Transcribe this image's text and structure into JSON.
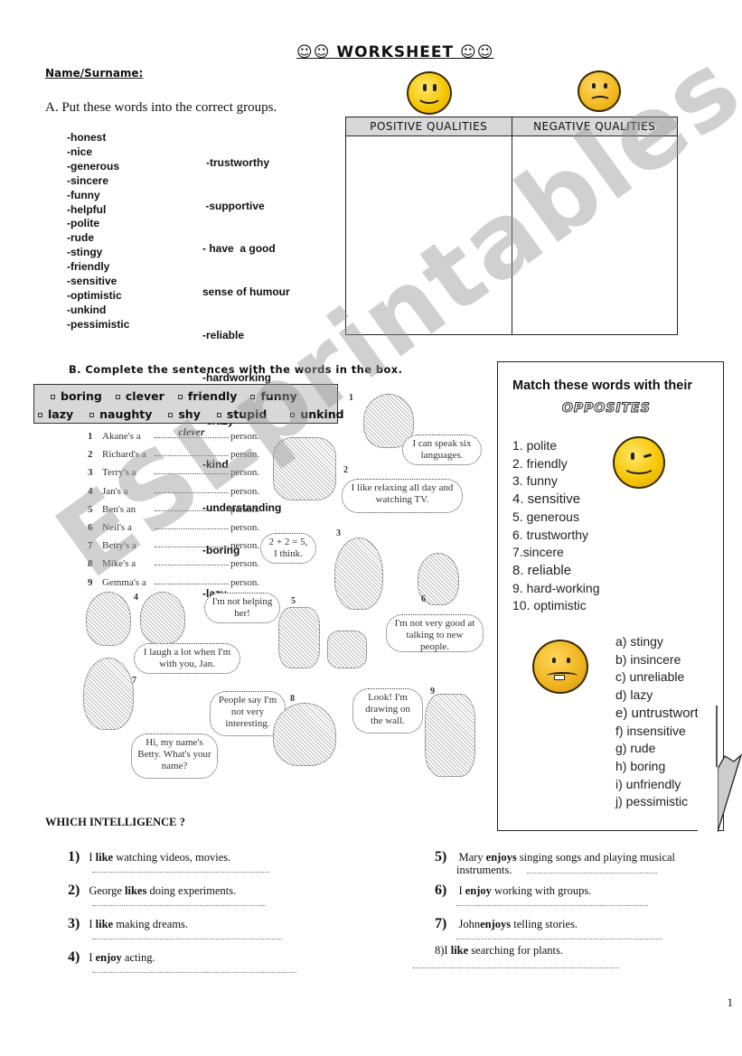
{
  "header": {
    "title": "☺☺ WORKSHEET ☺☺",
    "name_label": "Name/Surname:"
  },
  "section_a": {
    "instruction": "A.  Put these words into the correct groups.",
    "words_col1": [
      "-honest",
      "-nice",
      "-generous",
      "-sincere",
      "-funny",
      "-helpful",
      "-polite",
      "-rude",
      "-stingy",
      "-friendly",
      "-sensitive",
      "-optimistic",
      "-unkind",
      "-pessimistic"
    ],
    "words_col2": [
      "-trustworthy",
      " -supportive",
      "- have  a good",
      "sense of humour",
      "-reliable",
      "-hardworking",
      "-crazy",
      "-kind",
      "-understanding",
      "-boring",
      "-lazy"
    ],
    "table": {
      "positive_header": "POSITIVE QUALITIES",
      "negative_header": "NEGATIVE QUALITIES",
      "positive_icon": "happy-smiley-icon",
      "negative_icon": "sad-smiley-icon"
    }
  },
  "section_b": {
    "instruction": "B.  Complete the sentences with the words in the box.",
    "word_box_row1": [
      "boring",
      "clever",
      "friendly",
      "funny"
    ],
    "word_box_row2": [
      "lazy",
      "naughty",
      "shy",
      "stupid",
      "unkind"
    ],
    "sentences": [
      {
        "num": "1",
        "subject": "Akane's a",
        "answer": "clever",
        "end": "person."
      },
      {
        "num": "2",
        "subject": "Richard's a",
        "answer": "",
        "end": "person."
      },
      {
        "num": "3",
        "subject": "Terry's a",
        "answer": "",
        "end": "person."
      },
      {
        "num": "4",
        "subject": "Jan's a",
        "answer": "",
        "end": "person."
      },
      {
        "num": "5",
        "subject": "Ben's an",
        "answer": "",
        "end": "person."
      },
      {
        "num": "6",
        "subject": "Neil's a",
        "answer": "",
        "end": "person."
      },
      {
        "num": "7",
        "subject": "Betty's a",
        "answer": "",
        "end": "person."
      },
      {
        "num": "8",
        "subject": "Mike's a",
        "answer": "",
        "end": "person."
      },
      {
        "num": "9",
        "subject": "Gemma's a",
        "answer": "",
        "end": "person."
      }
    ],
    "bubbles": {
      "b1": "I can speak six languages.",
      "b2": "I like relaxing all day and watching TV.",
      "b3": "2 + 2 = 5, I think.",
      "b4": "I laugh a lot when I'm with you, Jan.",
      "b5": "I'm not helping her!",
      "b6": "I'm not very good at talking to new people.",
      "b7": "Hi, my name's Betty. What's your name?",
      "b8": "People say I'm not very interesting.",
      "b9": "Look! I'm drawing on the wall."
    },
    "figure_numbers": [
      "1",
      "2",
      "3",
      "4",
      "5",
      "6",
      "7",
      "8",
      "9"
    ]
  },
  "match": {
    "title": "Match these words with their",
    "subtitle": "OPPOSITES",
    "words": [
      "1. polite",
      "2. friendly",
      "3. funny",
      "4. sensitive",
      "5. generous",
      "6. trustworthy",
      "7.sincere",
      "8. reliable",
      "9. hard-working",
      "10. optimistic"
    ],
    "opposites": [
      "a) stingy",
      "b) insincere",
      "c) unreliable",
      "d) lazy",
      "e) untrustworthy",
      "f) insensitive",
      "g) rude",
      "h) boring",
      "i) unfriendly",
      "j) pessimistic"
    ],
    "icons": [
      "winking-smiley-icon",
      "angry-smiley-icon"
    ]
  },
  "intelligence": {
    "title": "WHICH INTELLIGENCE ?",
    "items": [
      {
        "num": "1)",
        "pre": "I ",
        "bold": "like",
        "post": " watching videos, movies."
      },
      {
        "num": "2)",
        "pre": "George ",
        "bold": "likes",
        "post": " doing experiments."
      },
      {
        "num": "3)",
        "pre": "I ",
        "bold": "like",
        "post": " making dreams."
      },
      {
        "num": "4)",
        "pre": "I ",
        "bold": "enjoy",
        "post": " acting."
      },
      {
        "num": "5)",
        "pre": " Mary ",
        "bold": "enjoys",
        "post": " singing songs and playing musical"
      },
      {
        "num": "6)",
        "pre": " I ",
        "bold": "enjoy",
        "post": " working with groups."
      },
      {
        "num": "7)",
        "pre": " John",
        "bold": "enjoys",
        "post": " telling stories."
      },
      {
        "num": "8)",
        "pre": "I ",
        "bold": "like",
        "post": " searching for plants."
      }
    ],
    "item5_cont": "instruments."
  },
  "watermark": "ESLprintables.com",
  "page_number": "1"
}
